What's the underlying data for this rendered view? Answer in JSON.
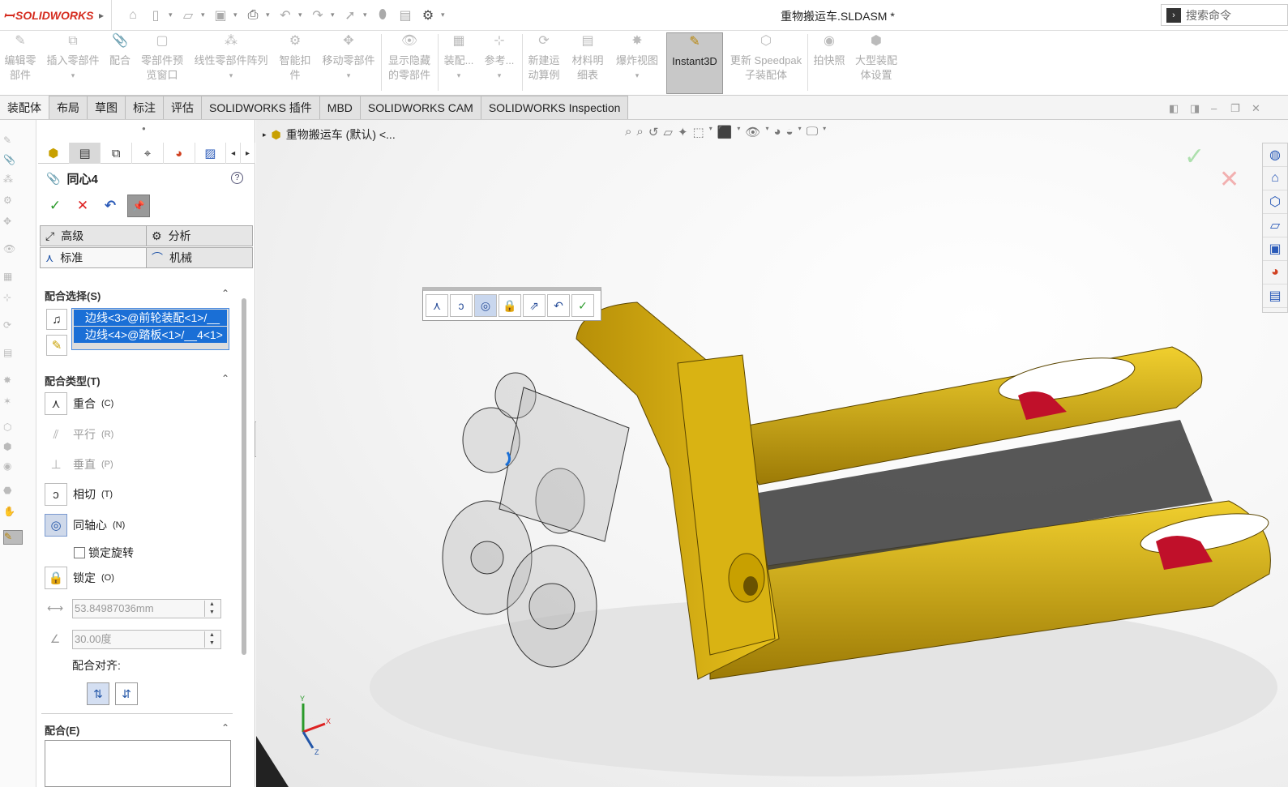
{
  "app": {
    "brand": "SOLIDWORKS",
    "doc_title": "重物搬运车.SLDASM *",
    "search_placeholder": "搜索命令"
  },
  "ribbon": [
    {
      "label": "编辑零\n部件",
      "icon": "edit-component-icon"
    },
    {
      "label": "插入零部件",
      "icon": "insert-component-icon"
    },
    {
      "label": "配合",
      "icon": "mate-icon"
    },
    {
      "label": "零部件预\n览窗口",
      "icon": "preview-window-icon"
    },
    {
      "label": "线性零部件阵列",
      "icon": "linear-pattern-icon"
    },
    {
      "label": "智能扣\n件",
      "icon": "smart-fastener-icon"
    },
    {
      "label": "移动零部件",
      "icon": "move-component-icon"
    },
    {
      "label": "显示隐藏\n的零部件",
      "icon": "show-hidden-icon"
    },
    {
      "label": "装配...",
      "icon": "assembly-features-icon"
    },
    {
      "label": "参考...",
      "icon": "reference-geometry-icon"
    },
    {
      "label": "新建运\n动算例",
      "icon": "motion-study-icon"
    },
    {
      "label": "材料明\n细表",
      "icon": "bom-icon"
    },
    {
      "label": "爆炸视图",
      "icon": "exploded-view-icon"
    },
    {
      "label": "Instant3D",
      "icon": "instant3d-icon"
    },
    {
      "label": "更新 Speedpak\n子装配体",
      "icon": "speedpak-icon"
    },
    {
      "label": "拍快照",
      "icon": "snapshot-icon"
    },
    {
      "label": "大型装配\n体设置",
      "icon": "large-assembly-icon"
    }
  ],
  "tabs": [
    "装配体",
    "布局",
    "草图",
    "标注",
    "评估",
    "SOLIDWORKS 插件",
    "MBD",
    "SOLIDWORKS CAM",
    "SOLIDWORKS Inspection"
  ],
  "pm": {
    "title": "同心4",
    "seg": {
      "advanced": "高级",
      "analysis": "分析",
      "standard": "标准",
      "mechanical": "机械"
    },
    "mate_selections": "配合选择(S)",
    "sel1": "边线<3>@前轮装配<1>/__",
    "sel2": "边线<4>@踏板<1>/__4<1>",
    "mate_types": "配合类型(T)",
    "types": {
      "coincident": "重合",
      "coincident_key": "(C)",
      "parallel": "平行",
      "parallel_key": "(R)",
      "perpendicular": "垂直",
      "perpendicular_key": "(P)",
      "tangent": "相切",
      "tangent_key": "(T)",
      "concentric": "同轴心",
      "concentric_key": "(N)",
      "lock": "锁定",
      "lock_key": "(O)"
    },
    "lock_rotation": "锁定旋转",
    "distance": "53.84987036mm",
    "angle": "30.00度",
    "alignment": "配合对齐:",
    "mates": "配合(E)"
  },
  "viewport": {
    "tree_label": "重物搬运车 (默认) <..."
  },
  "colors": {
    "accent": "#1a6fd6",
    "brand": "#d52b1e",
    "frame_yellow": "#d4ac0d",
    "wheel_red": "#c0102a"
  }
}
